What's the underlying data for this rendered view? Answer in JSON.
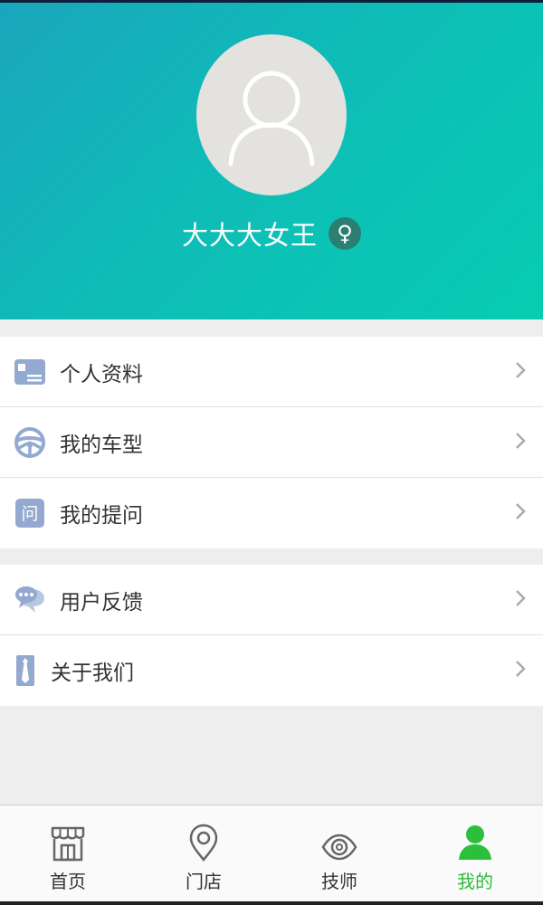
{
  "profile": {
    "username": "大大大女王",
    "gender_symbol": "♀"
  },
  "menu": {
    "group1": [
      {
        "label": "个人资料",
        "icon": "id-card-icon"
      },
      {
        "label": "我的车型",
        "icon": "steering-wheel-icon"
      },
      {
        "label": "我的提问",
        "icon": "question-icon",
        "icon_text": "问"
      }
    ],
    "group2": [
      {
        "label": "用户反馈",
        "icon": "chat-bubbles-icon"
      },
      {
        "label": "关于我们",
        "icon": "tie-icon"
      }
    ]
  },
  "tabbar": {
    "tabs": [
      {
        "label": "首页",
        "icon": "storefront-icon",
        "active": false
      },
      {
        "label": "门店",
        "icon": "location-pin-icon",
        "active": false
      },
      {
        "label": "技师",
        "icon": "eye-icon",
        "active": false
      },
      {
        "label": "我的",
        "icon": "person-icon",
        "active": true
      }
    ]
  },
  "colors": {
    "header_gradient_start": "#1aa6bd",
    "header_gradient_end": "#06cdb2",
    "menu_icon": "#93a9cf",
    "active_tab": "#2bbf3c",
    "gender_badge": "#2b7f72"
  }
}
